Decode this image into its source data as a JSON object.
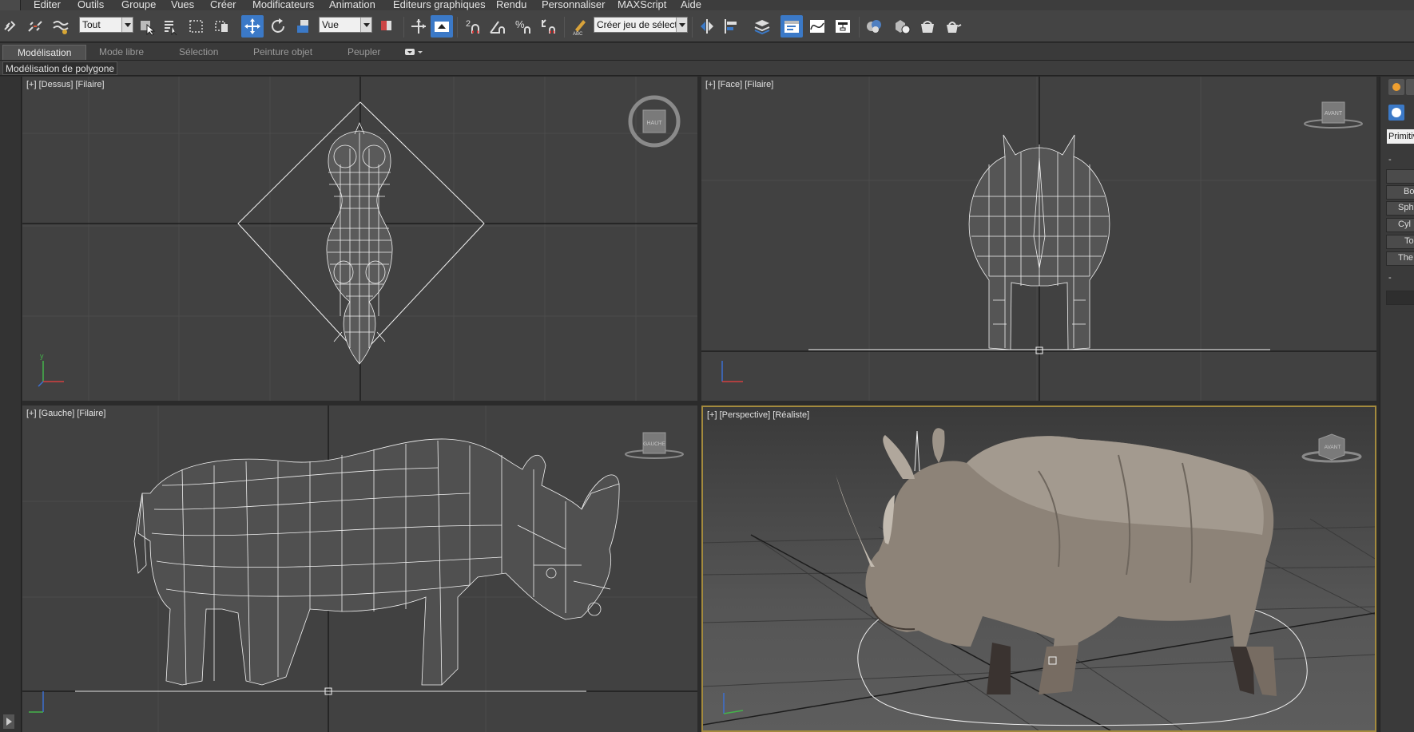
{
  "menu": {
    "items": [
      "Editer",
      "Outils",
      "Groupe",
      "Vues",
      "Créer",
      "Modificateurs",
      "Animation",
      "Editeurs graphiques",
      "Rendu",
      "Personnaliser",
      "MAXScript",
      "Aide"
    ]
  },
  "toolbar": {
    "selection_filter": "Tout",
    "ref_coord": "Vue",
    "named_selection": "Créer jeu de sélecti"
  },
  "ribbon": {
    "tabs": [
      "Modélisation",
      "Mode libre",
      "Sélection",
      "Peinture objet",
      "Peupler"
    ],
    "active_tab": "Modélisation",
    "sub_panel": "Modélisation de polygone"
  },
  "viewports": {
    "top": {
      "plus": "[+]",
      "view": "[Dessus]",
      "shading": "[Filaire]",
      "cube_label": "HAUT"
    },
    "front": {
      "plus": "[+]",
      "view": "[Face]",
      "shading": "[Filaire]",
      "cube_label": "AVANT"
    },
    "left": {
      "plus": "[+]",
      "view": "[Gauche]",
      "shading": "[Filaire]",
      "cube_label": "GAUCHE"
    },
    "perspective": {
      "plus": "[+]",
      "view": "[Perspective]",
      "shading": "[Réaliste]",
      "cube_label": "AVANT"
    }
  },
  "command_panel": {
    "dropdown": "Primitiv",
    "buttons": [
      "Bo",
      "Sph",
      "Cyl",
      "To",
      "The"
    ]
  },
  "axis": {
    "x": "x",
    "y": "y",
    "z": "z"
  },
  "colors": {
    "accent": "#3b79c7",
    "active_viewport_border": "#a38a3e",
    "viewport_bg": "#414141",
    "wire": "#f2f2f2",
    "rhino_skin": "#8d8378"
  }
}
